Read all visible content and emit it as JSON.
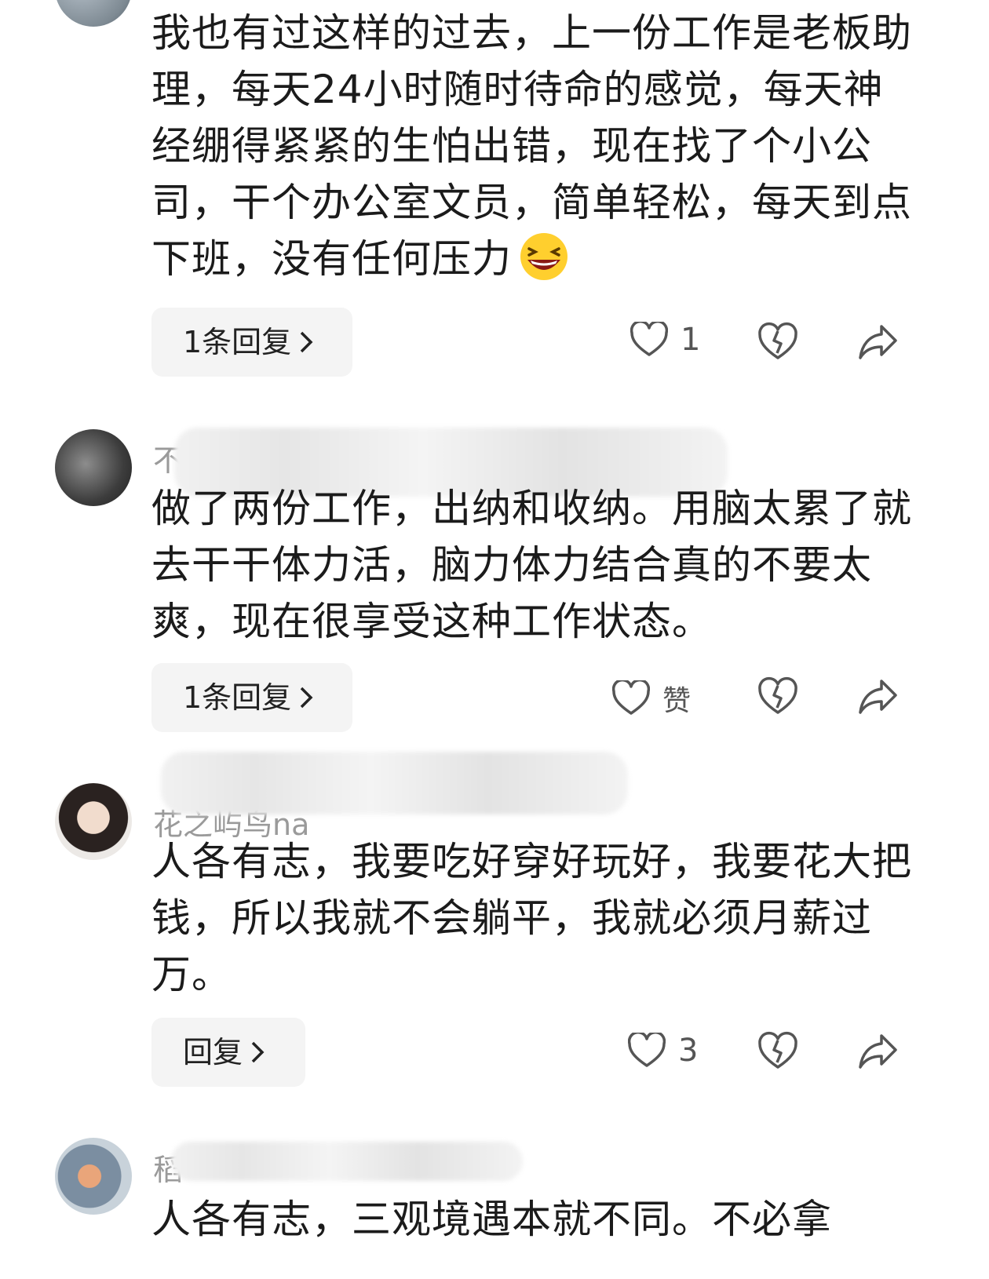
{
  "comments": [
    {
      "username": "",
      "text": "我也有过这样的过去，上一份工作是老板助理，每天24小时随时待命的感觉，每天神经绷得紧紧的生怕出错，现在找了个小公司，干个办公室文员，简单轻松，每天到点下班，没有任何压力",
      "emoji": "laughing-face",
      "reply_label": "1条回复",
      "like_count": "1"
    },
    {
      "username": "不",
      "text": "做了两份工作，出纳和收纳。用脑太累了就去干干体力活，脑力体力结合真的不要太爽，现在很享受这种工作状态。",
      "reply_label": "1条回复",
      "like_count": "赞"
    },
    {
      "username": "花之屿鸟na",
      "text": "人各有志，我要吃好穿好玩好，我要花大把钱，所以我就不会躺平，我就必须月薪过万。",
      "reply_label": "回复",
      "like_count": "3"
    },
    {
      "username": "稻",
      "text": "人各有志，三观境遇本就不同。不必拿"
    }
  ],
  "icons": {
    "like": "heart-outline-icon",
    "dislike": "broken-heart-icon",
    "share": "share-arrow-icon",
    "chevron": "chevron-right-icon"
  },
  "colors": {
    "text": "#1b1b1b",
    "muted": "#9a9a9a",
    "button_bg": "#f4f4f4"
  }
}
